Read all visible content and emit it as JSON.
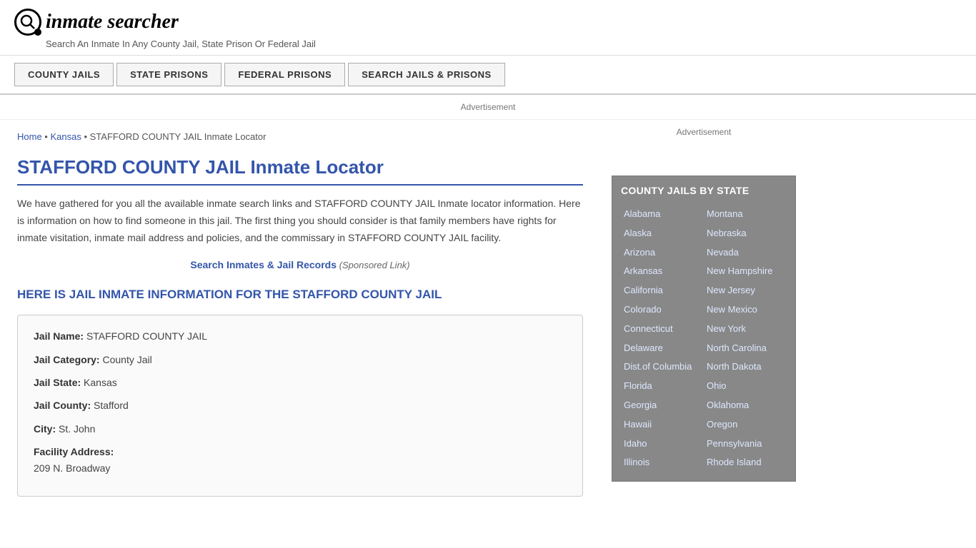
{
  "header": {
    "logo_text": "inmate searcher",
    "tagline": "Search An Inmate In Any County Jail, State Prison Or Federal Jail"
  },
  "nav": {
    "items": [
      {
        "label": "COUNTY JAILS",
        "href": "#"
      },
      {
        "label": "STATE PRISONS",
        "href": "#"
      },
      {
        "label": "FEDERAL PRISONS",
        "href": "#"
      },
      {
        "label": "SEARCH JAILS & PRISONS",
        "href": "#"
      }
    ]
  },
  "ad_label": "Advertisement",
  "breadcrumb": {
    "home": "Home",
    "separator1": " • ",
    "kansas": "Kansas",
    "separator2": " • ",
    "current": "STAFFORD COUNTY JAIL Inmate Locator"
  },
  "page_title": "STAFFORD COUNTY JAIL Inmate Locator",
  "description": "We have gathered for you all the available inmate search links and STAFFORD COUNTY JAIL Inmate locator information. Here is information on how to find someone in this jail. The first thing you should consider is that family members have rights for inmate visitation, inmate mail address and policies, and the commissary in STAFFORD COUNTY JAIL facility.",
  "sponsored": {
    "link_text": "Search Inmates & Jail Records",
    "suffix": " (Sponsored Link)"
  },
  "section_heading": "HERE IS JAIL INMATE INFORMATION FOR THE STAFFORD COUNTY JAIL",
  "jail_info": {
    "name_label": "Jail Name:",
    "name_value": "STAFFORD COUNTY JAIL",
    "category_label": "Jail Category:",
    "category_value": "County Jail",
    "state_label": "Jail State:",
    "state_value": "Kansas",
    "county_label": "Jail County:",
    "county_value": "Stafford",
    "city_label": "City:",
    "city_value": "St. John",
    "address_label": "Facility Address:",
    "address_value": "209 N. Broadway"
  },
  "sidebar": {
    "ad_label": "Advertisement",
    "box_title": "COUNTY JAILS BY STATE",
    "states_left": [
      "Alabama",
      "Alaska",
      "Arizona",
      "Arkansas",
      "California",
      "Colorado",
      "Connecticut",
      "Delaware",
      "Dist.of Columbia",
      "Florida",
      "Georgia",
      "Hawaii",
      "Idaho",
      "Illinois"
    ],
    "states_right": [
      "Montana",
      "Nebraska",
      "Nevada",
      "New Hampshire",
      "New Jersey",
      "New Mexico",
      "New York",
      "North Carolina",
      "North Dakota",
      "Ohio",
      "Oklahoma",
      "Oregon",
      "Pennsylvania",
      "Rhode Island"
    ]
  }
}
